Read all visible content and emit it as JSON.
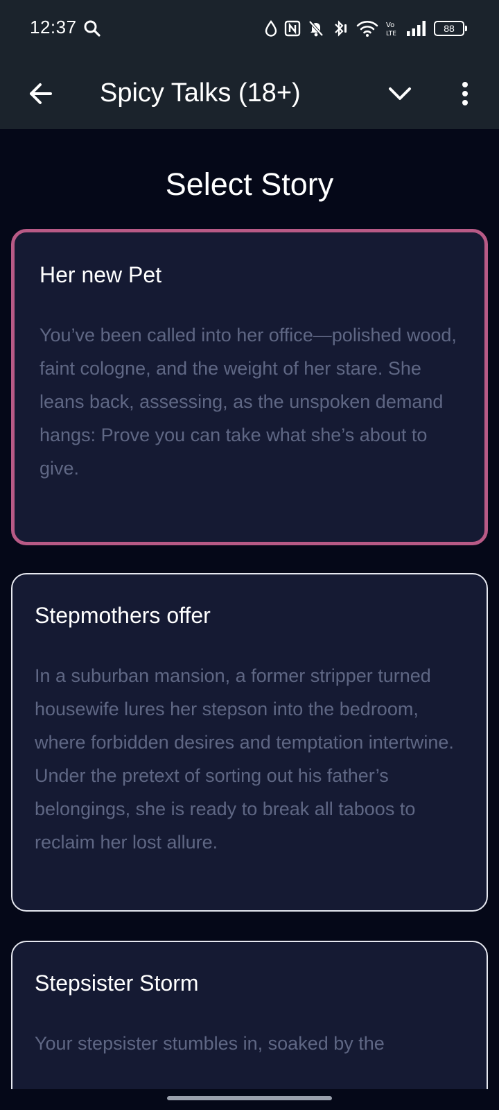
{
  "status_bar": {
    "time": "12:37",
    "battery": "88",
    "icons": [
      "search-icon",
      "drop-icon",
      "nfc-icon",
      "mute-bell-icon",
      "bluetooth-vibrate-icon",
      "wifi-icon",
      "volte-icon",
      "signal-icon",
      "battery-icon"
    ]
  },
  "app_bar": {
    "title": "Spicy Talks (18+)",
    "icons": [
      "back-arrow-icon",
      "chevron-down-icon",
      "more-vert-icon"
    ]
  },
  "page": {
    "title": "Select Story"
  },
  "stories": [
    {
      "title": "Her new Pet",
      "description": "You’ve been called into her office—polished wood, faint cologne, and the weight of her stare. She leans back, assessing, as the unspoken demand hangs: Prove you can take what she’s about to give.",
      "selected": true
    },
    {
      "title": "Stepmothers offer",
      "description": "In a suburban mansion, a former stripper turned housewife lures her stepson into the bedroom, where forbidden desires and temptation intertwine. Under the pretext of sorting out his father’s belongings, she is ready to break all taboos to reclaim her lost allure.",
      "selected": false
    },
    {
      "title": "Stepsister Storm",
      "description": "Your stepsister stumbles in, soaked by the",
      "selected": false
    }
  ],
  "colors": {
    "background": "#050818",
    "bar": "#1b232c",
    "card": "#151a33",
    "selected_border": "#b85a86",
    "card_border": "#e6e8f0",
    "description_text": "#5f6784"
  }
}
